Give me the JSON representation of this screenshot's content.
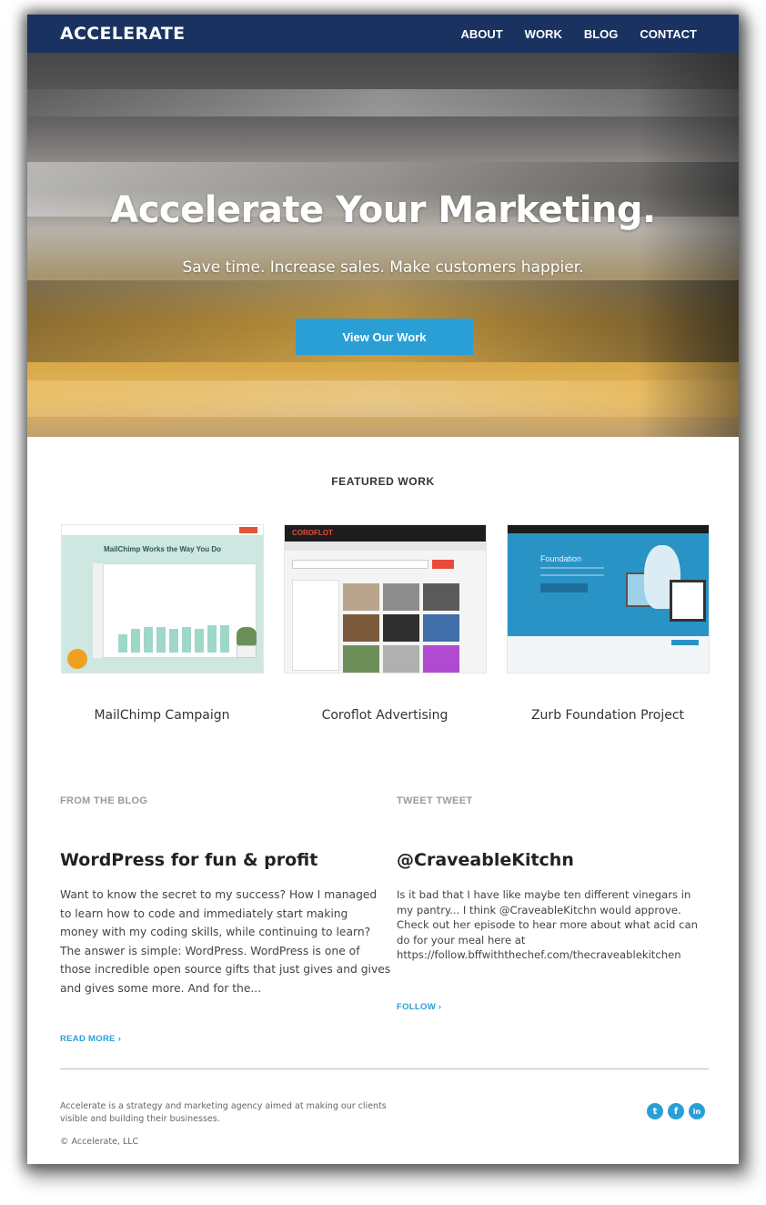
{
  "header": {
    "logo": "ACCELERATE",
    "nav": [
      "ABOUT",
      "WORK",
      "BLOG",
      "CONTACT"
    ]
  },
  "hero": {
    "title": "Accelerate Your Marketing.",
    "subtitle": "Save time. Increase sales. Make customers happier.",
    "button": "View Our Work"
  },
  "featured": {
    "title": "FEATURED WORK",
    "items": [
      {
        "label": "MailChimp Campaign",
        "screenshot_heading": "MailChimp Works the Way You Do"
      },
      {
        "label": "Coroflot Advertising",
        "screenshot_logo": "COROFLOT"
      },
      {
        "label": "Zurb Foundation Project",
        "screenshot_heading": "Foundation"
      }
    ]
  },
  "blog": {
    "section_label": "FROM THE BLOG",
    "title": "WordPress for fun & profit",
    "excerpt_lines": [
      "Want to know the secret to my success? How I managed",
      "to learn how to code and immediately start making",
      "money with my coding skills, while continuing to learn?",
      "The answer is simple: WordPress. WordPress is one of",
      "those incredible open source gifts that just gives and gives",
      "and gives some more. And for the..."
    ],
    "link": "READ MORE ›"
  },
  "tweet": {
    "section_label": "TWEET TWEET",
    "handle": "@CraveableKitchn",
    "text_lines": [
      "Is it bad that I have like maybe ten different vinegars in",
      "my pantry... I think @CraveableKitchn would approve.",
      "Check out her episode to hear more about what acid can",
      "do for your meal here at",
      "https://follow.bffwiththechef.com/thecraveablekitchen"
    ],
    "link": "FOLLOW ›"
  },
  "footer": {
    "about_lines": [
      "Accelerate is a strategy and marketing agency aimed at making our clients",
      "visible and building their businesses."
    ],
    "copyright": "© Accelerate, LLC",
    "socials": [
      {
        "icon": "twitter-icon",
        "glyph": "t"
      },
      {
        "icon": "facebook-icon",
        "glyph": "f"
      },
      {
        "icon": "linkedin-icon",
        "glyph": "in"
      }
    ]
  },
  "colors": {
    "navy": "#1a3260",
    "accent": "#2a9fd6"
  }
}
